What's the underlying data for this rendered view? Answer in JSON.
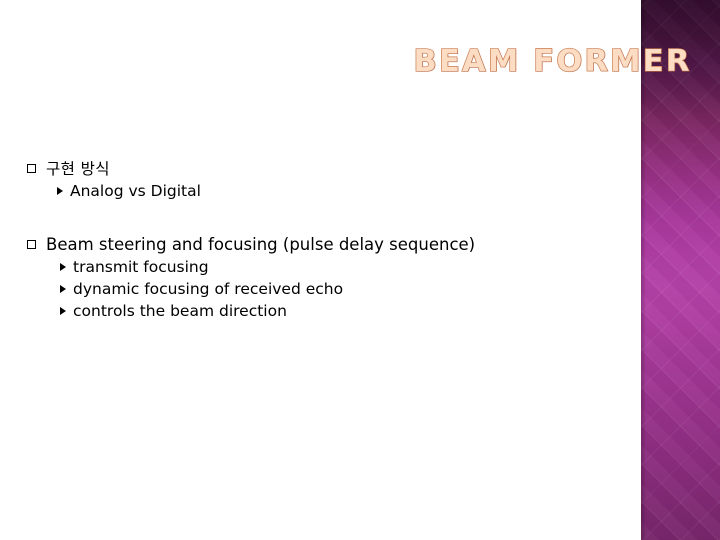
{
  "slide": {
    "title": "BEAM FORMER",
    "title_color": "#fcdcc3",
    "title_outline_color": "#c87a4e",
    "background_color": "#ffffff",
    "text_color": "#000000",
    "panel": {
      "accent_top_color": "#43123c",
      "accent_mid_color": "#b341a7",
      "accent_bottom_color": "#77266b",
      "pattern": "diamond-argyle"
    },
    "bullet_glyphs": {
      "level1": "□",
      "level2": "▶"
    },
    "content": [
      {
        "heading": "구현 방식",
        "items": [
          "Analog  vs  Digital"
        ]
      },
      {
        "heading": "Beam steering and focusing (pulse delay sequence)",
        "items": [
          "transmit focusing",
          "dynamic focusing of received echo",
          "controls the beam direction"
        ]
      }
    ]
  }
}
